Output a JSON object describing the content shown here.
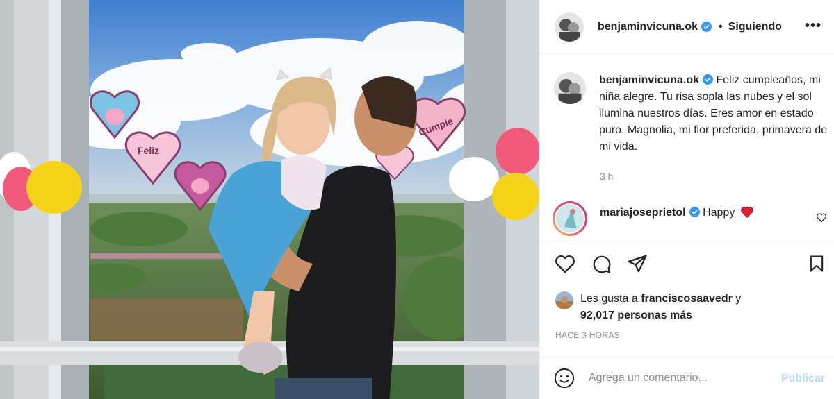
{
  "post": {
    "username": "benjaminvicuna.ok",
    "verified": true,
    "separator": "•",
    "follow_status": "Siguiendo",
    "more": "•••",
    "caption": "Feliz cumpleaños, mi niña alegre. Tu risa sopla las nubes y el sol ilumina nuestros días. Eres amor en estado puro. Magnolia, mi flor preferida, primavera de mi vida.",
    "caption_time": "3 h"
  },
  "comments": [
    {
      "username": "mariajoseprietol",
      "verified": true,
      "text": "Happy",
      "emoji": "heart"
    }
  ],
  "actions": {
    "like_icon": "heart-icon",
    "comment_icon": "speech-bubble-icon",
    "share_icon": "paper-plane-icon",
    "save_icon": "bookmark-icon"
  },
  "likes": {
    "prefix": "Les gusta a",
    "user": "franciscosaavedr",
    "conjunction": "y",
    "count": "92,017 personas más"
  },
  "posted_ago": "HACE 3 HORAS",
  "comment_box": {
    "placeholder": "Agrega un comentario...",
    "publish": "Publicar",
    "emoji_icon": "smiley-icon"
  },
  "photo": {
    "sign_feliz": "Feliz",
    "sign_cumple": "Cumple"
  },
  "colors": {
    "verified": "#3897f0",
    "publish_disabled": "#b3dbff",
    "heart_red": "#ed4956"
  }
}
